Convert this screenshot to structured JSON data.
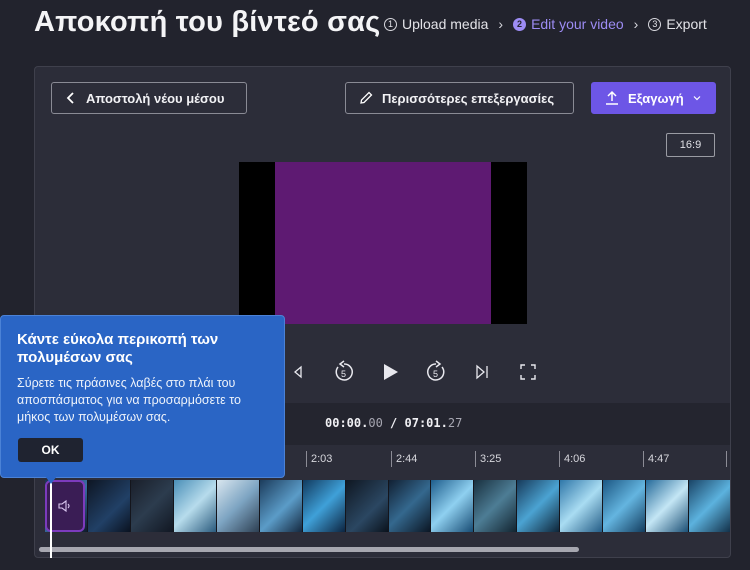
{
  "page": {
    "title": "Αποκοπή του βίντεό σας"
  },
  "steps": [
    {
      "num": "1",
      "label": "Upload media",
      "active": false
    },
    {
      "num": "2",
      "label": "Edit your video",
      "active": true
    },
    {
      "num": "3",
      "label": "Export",
      "active": false
    }
  ],
  "toolbar": {
    "back_label": "Αποστολή νέου μέσου",
    "edit_label": "Περισσότερες επεξεργασίες",
    "export_label": "Εξαγωγή"
  },
  "aspect_ratio": "16:9",
  "colors": {
    "accent": "#6d56e6",
    "tooltip": "#2a65c5",
    "video_fill": "#5e1a72"
  },
  "player": {
    "current_time_main": "00:00.",
    "current_time_frac": "00",
    "separator": " /",
    "total_time_main": " 07:01.",
    "total_time_frac": "27",
    "skip_seconds": "5"
  },
  "ruler_ticks": [
    "2:03",
    "2:44",
    "3:25",
    "4:06",
    "4:47"
  ],
  "tooltip": {
    "heading": "Κάντε εύκολα περικοπή των πολυμέσων σας",
    "body": "Σύρετε τις πράσινες λαβές στο πλάι του αποσπάσματος για να προσαρμόσετε το μήκος των πολυμέσων σας.",
    "ok_label": "OK"
  },
  "icons": [
    "chevron-left-icon",
    "pencil-icon",
    "upload-icon",
    "chevron-down-icon",
    "skip-to-start-icon",
    "rewind-5-icon",
    "play-icon",
    "forward-5-icon",
    "skip-to-end-icon",
    "fullscreen-icon",
    "speaker-icon"
  ]
}
